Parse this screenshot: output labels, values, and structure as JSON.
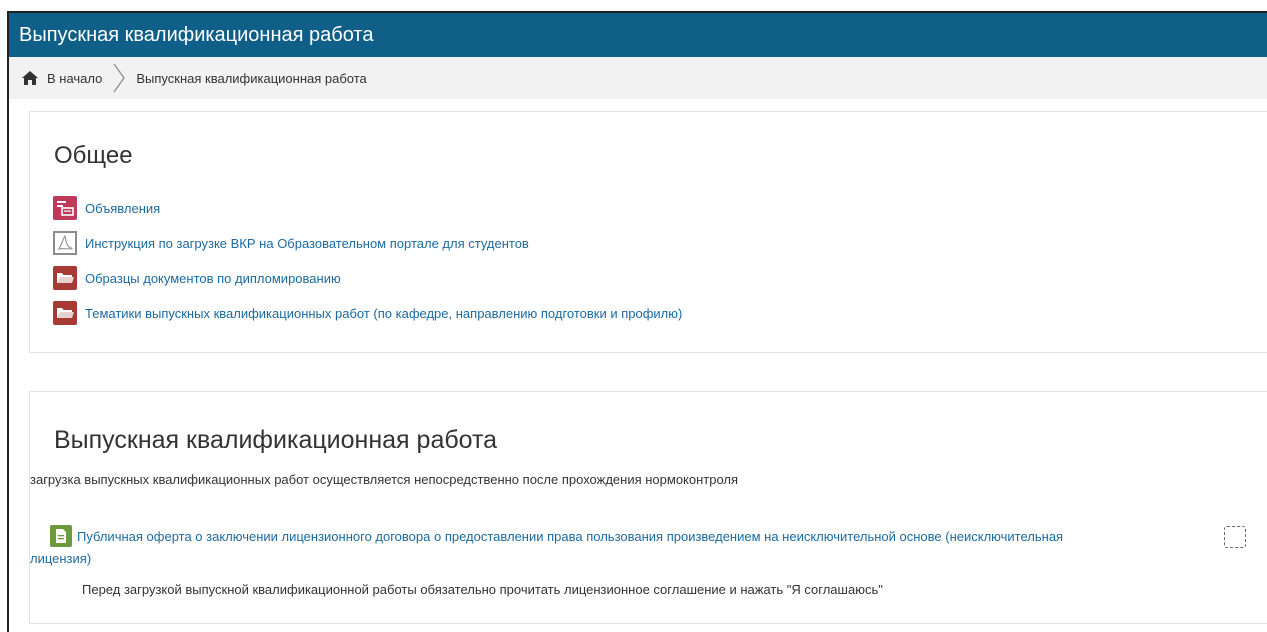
{
  "header": {
    "title": "Выпускная квалификационная работа"
  },
  "breadcrumb": {
    "home_label": "В начало",
    "current_label": "Выпускная квалификационная работа"
  },
  "sections": {
    "general": {
      "title": "Общее",
      "activities": [
        {
          "label": "Объявления",
          "icon": "forum-icon"
        },
        {
          "label": "Инструкция по загрузке ВКР на Образовательном портале для студентов",
          "icon": "pdf-icon"
        },
        {
          "label": "Образцы документов по дипломированию",
          "icon": "folder-icon"
        },
        {
          "label": "Тематики выпускных квалификационных работ (по кафедре, направлению подготовки и профилю)",
          "icon": "folder-icon"
        }
      ]
    },
    "vkr": {
      "title": "Выпускная квалификационная работа",
      "summary": "загрузка выпускных квалификационных работ осуществляется непосредственно после прохождения нормоконтроля",
      "offer_line1": "Публичная оферта о заключении лицензионного договора о предоставлении права пользования произведением на неисключительной основе (неисключительная",
      "offer_line2": "лицензия)",
      "offer_note": "Перед загрузкой выпускной квалификационной работы обязательно прочитать лицензионное соглашение и нажать \"Я соглашаюсь\""
    }
  },
  "colors": {
    "header_bg": "#0f5f89",
    "link": "#1c6aa0",
    "forum_icon": "#c0395a",
    "folder_icon": "#a83a35",
    "page_icon": "#6a9a3a"
  }
}
